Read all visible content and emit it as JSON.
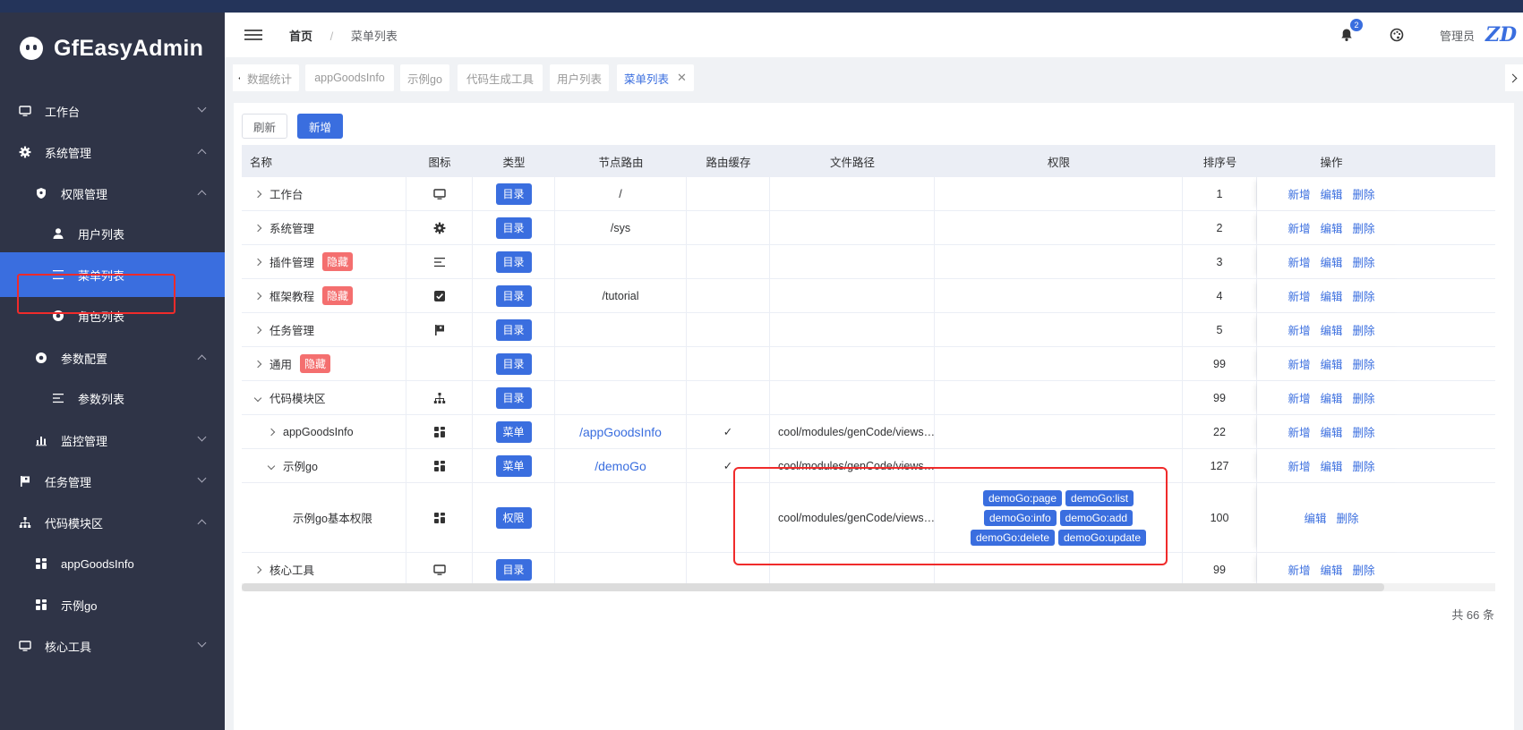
{
  "app": {
    "title": "GfEasyAdmin"
  },
  "sidebar": {
    "items": [
      {
        "label": "工作台",
        "icon": "monitor-icon",
        "chevron": "down"
      },
      {
        "label": "系统管理",
        "icon": "gear-icon",
        "chevron": "up"
      },
      {
        "label": "权限管理",
        "icon": "shield-icon",
        "chevron": "up"
      },
      {
        "label": "用户列表",
        "icon": "user-icon",
        "chevron": ""
      },
      {
        "label": "菜单列表",
        "icon": "menu-lines-icon",
        "chevron": "",
        "active": true
      },
      {
        "label": "角色列表",
        "icon": "radio-dot-icon",
        "chevron": ""
      },
      {
        "label": "参数配置",
        "icon": "radio-dot-icon",
        "chevron": "up"
      },
      {
        "label": "参数列表",
        "icon": "menu-lines-icon",
        "chevron": ""
      },
      {
        "label": "监控管理",
        "icon": "bar-chart-icon",
        "chevron": "down"
      },
      {
        "label": "任务管理",
        "icon": "flag-icon",
        "chevron": "down"
      },
      {
        "label": "代码模块区",
        "icon": "hierarchy-icon",
        "chevron": "up"
      },
      {
        "label": "appGoodsInfo",
        "icon": "grid-icon",
        "chevron": ""
      },
      {
        "label": "示例go",
        "icon": "grid-icon",
        "chevron": ""
      },
      {
        "label": "核心工具",
        "icon": "monitor-icon",
        "chevron": "down"
      }
    ]
  },
  "header": {
    "breadcrumb_home": "首页",
    "breadcrumb_sep": "/",
    "breadcrumb_current": "菜单列表",
    "notification_count": "2",
    "username": "管理员",
    "avatar_text": "ZD"
  },
  "tabs": [
    {
      "label": "数据统计"
    },
    {
      "label": "appGoodsInfo"
    },
    {
      "label": "示例go"
    },
    {
      "label": "代码生成工具"
    },
    {
      "label": "用户列表"
    },
    {
      "label": "菜单列表",
      "active": true,
      "close": "✕"
    }
  ],
  "toolbar": {
    "refresh_label": "刷新",
    "add_label": "新增"
  },
  "table": {
    "columns": [
      "名称",
      "图标",
      "类型",
      "节点路由",
      "路由缓存",
      "文件路径",
      "权限",
      "排序号",
      "操作"
    ],
    "rows": [
      {
        "name": "工作台",
        "hidden": "",
        "icon": "monitor-icon",
        "type": "目录",
        "route": "/",
        "route_link": false,
        "cache": "",
        "path": "",
        "perms": [],
        "order": "1",
        "ops": [
          "新增",
          "编辑",
          "删除"
        ]
      },
      {
        "name": "系统管理",
        "hidden": "",
        "icon": "gear-icon",
        "type": "目录",
        "route": "/sys",
        "route_link": false,
        "cache": "",
        "path": "",
        "perms": [],
        "order": "2",
        "ops": [
          "新增",
          "编辑",
          "删除"
        ]
      },
      {
        "name": "插件管理",
        "hidden": "隐藏",
        "icon": "menu-lines-icon",
        "type": "目录",
        "route": "",
        "route_link": false,
        "cache": "",
        "path": "",
        "perms": [],
        "order": "3",
        "ops": [
          "新增",
          "编辑",
          "删除"
        ]
      },
      {
        "name": "框架教程",
        "hidden": "隐藏",
        "icon": "checkbox-icon",
        "type": "目录",
        "route": "/tutorial",
        "route_link": false,
        "cache": "",
        "path": "",
        "perms": [],
        "order": "4",
        "ops": [
          "新增",
          "编辑",
          "删除"
        ]
      },
      {
        "name": "任务管理",
        "hidden": "",
        "icon": "flag-icon",
        "type": "目录",
        "route": "",
        "route_link": false,
        "cache": "",
        "path": "",
        "perms": [],
        "order": "5",
        "ops": [
          "新增",
          "编辑",
          "删除"
        ]
      },
      {
        "name": "通用",
        "hidden": "隐藏",
        "icon": "",
        "type": "目录",
        "route": "",
        "route_link": false,
        "cache": "",
        "path": "",
        "perms": [],
        "order": "99",
        "ops": [
          "新增",
          "编辑",
          "删除"
        ]
      },
      {
        "name": "代码模块区",
        "hidden": "",
        "icon": "hierarchy-icon",
        "type": "目录",
        "route": "",
        "route_link": false,
        "cache": "",
        "path": "",
        "perms": [],
        "order": "99",
        "ops": [
          "新增",
          "编辑",
          "删除"
        ],
        "expanded": true
      },
      {
        "name": "appGoodsInfo",
        "hidden": "",
        "icon": "grid-icon",
        "type": "菜单",
        "route": "/appGoodsInfo",
        "route_link": true,
        "cache": "✓",
        "path": "cool/modules/genCode/views…",
        "perms": [],
        "order": "22",
        "ops": [
          "新增",
          "编辑",
          "删除"
        ],
        "level": 1
      },
      {
        "name": "示例go",
        "hidden": "",
        "icon": "grid-icon",
        "type": "菜单",
        "route": "/demoGo",
        "route_link": true,
        "cache": "✓",
        "path": "cool/modules/genCode/views…",
        "perms": [],
        "order": "127",
        "ops": [
          "新增",
          "编辑",
          "删除"
        ],
        "level": 1,
        "expanded": true
      },
      {
        "name": "示例go基本权限",
        "hidden": "",
        "icon": "grid-icon",
        "type": "权限",
        "route": "",
        "route_link": false,
        "cache": "",
        "path": "cool/modules/genCode/views…",
        "perms": [
          [
            "demoGo:page",
            "demoGo:list"
          ],
          [
            "demoGo:info",
            "demoGo:add"
          ],
          [
            "demoGo:delete",
            "demoGo:update"
          ]
        ],
        "order": "100",
        "ops": [
          "编辑",
          "删除"
        ],
        "level": 2,
        "leaf": true
      },
      {
        "name": "核心工具",
        "hidden": "",
        "icon": "monitor-icon",
        "type": "目录",
        "route": "",
        "route_link": false,
        "cache": "",
        "path": "",
        "perms": [],
        "order": "99",
        "ops": [
          "新增",
          "编辑",
          "删除"
        ]
      }
    ]
  },
  "pagination": {
    "total_label": "共 66 条"
  },
  "colors": {
    "primary": "#3a6edf",
    "sidebar_bg": "#2f3447",
    "danger": "#f46f6f",
    "highlight": "#f02b2b"
  }
}
